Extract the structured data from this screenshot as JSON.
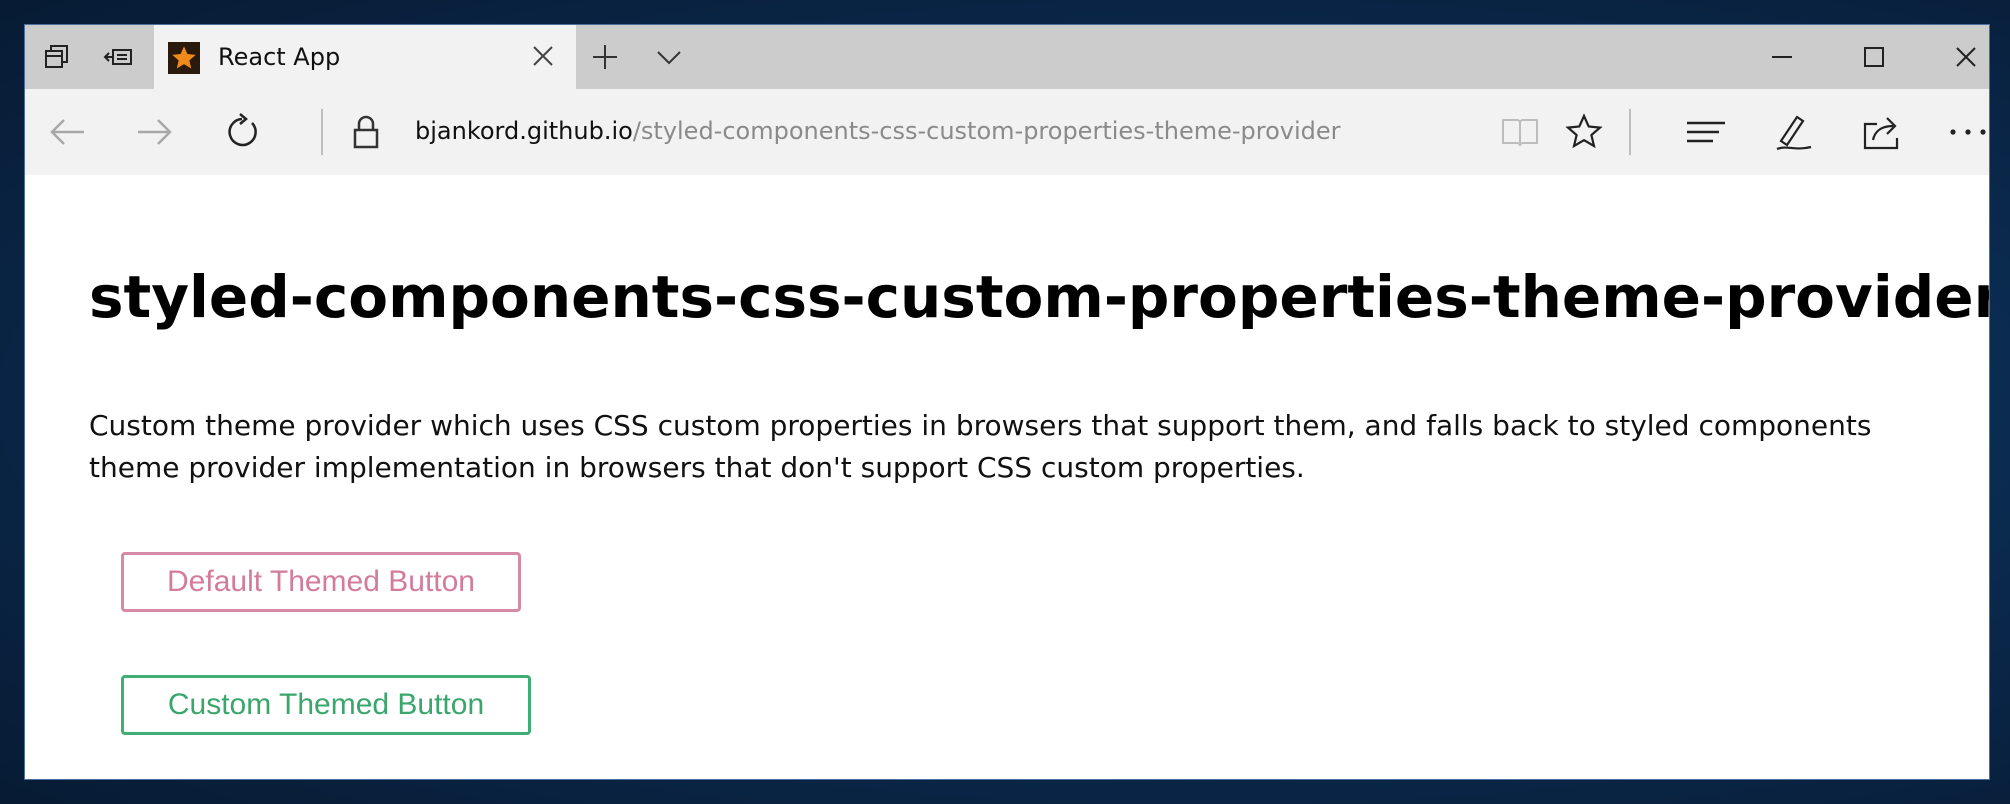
{
  "browser": {
    "tab": {
      "title": "React App",
      "favicon": "star-favicon-icon"
    },
    "toolbar_icons": [
      "tab-preview-icon",
      "set-aside-tabs-icon",
      "new-tab-icon",
      "tab-list-chevron-icon"
    ],
    "window_controls": [
      "minimize-icon",
      "maximize-icon",
      "close-icon"
    ],
    "nav": [
      "back-icon",
      "forward-icon",
      "refresh-icon",
      "lock-icon"
    ],
    "address": {
      "host": "bjankord.github.io",
      "path": "/styled-components-css-custom-properties-theme-provider"
    },
    "right_icons": [
      "reading-view-icon",
      "favorite-star-icon",
      "hub-icon",
      "web-note-icon",
      "share-icon",
      "more-icon"
    ]
  },
  "page": {
    "title": "styled-components-css-custom-properties-theme-provider",
    "description": "Custom theme provider which uses CSS custom properties in browsers that support them, and falls back to styled components theme provider implementation in browsers that don't support CSS custom properties.",
    "buttons": {
      "default_label": "Default Themed Button",
      "custom_label": "Custom Themed Button"
    }
  },
  "colors": {
    "default_button": "#d37b9b",
    "custom_button": "#3aa56c",
    "desktop_background": "#0b2c52"
  }
}
